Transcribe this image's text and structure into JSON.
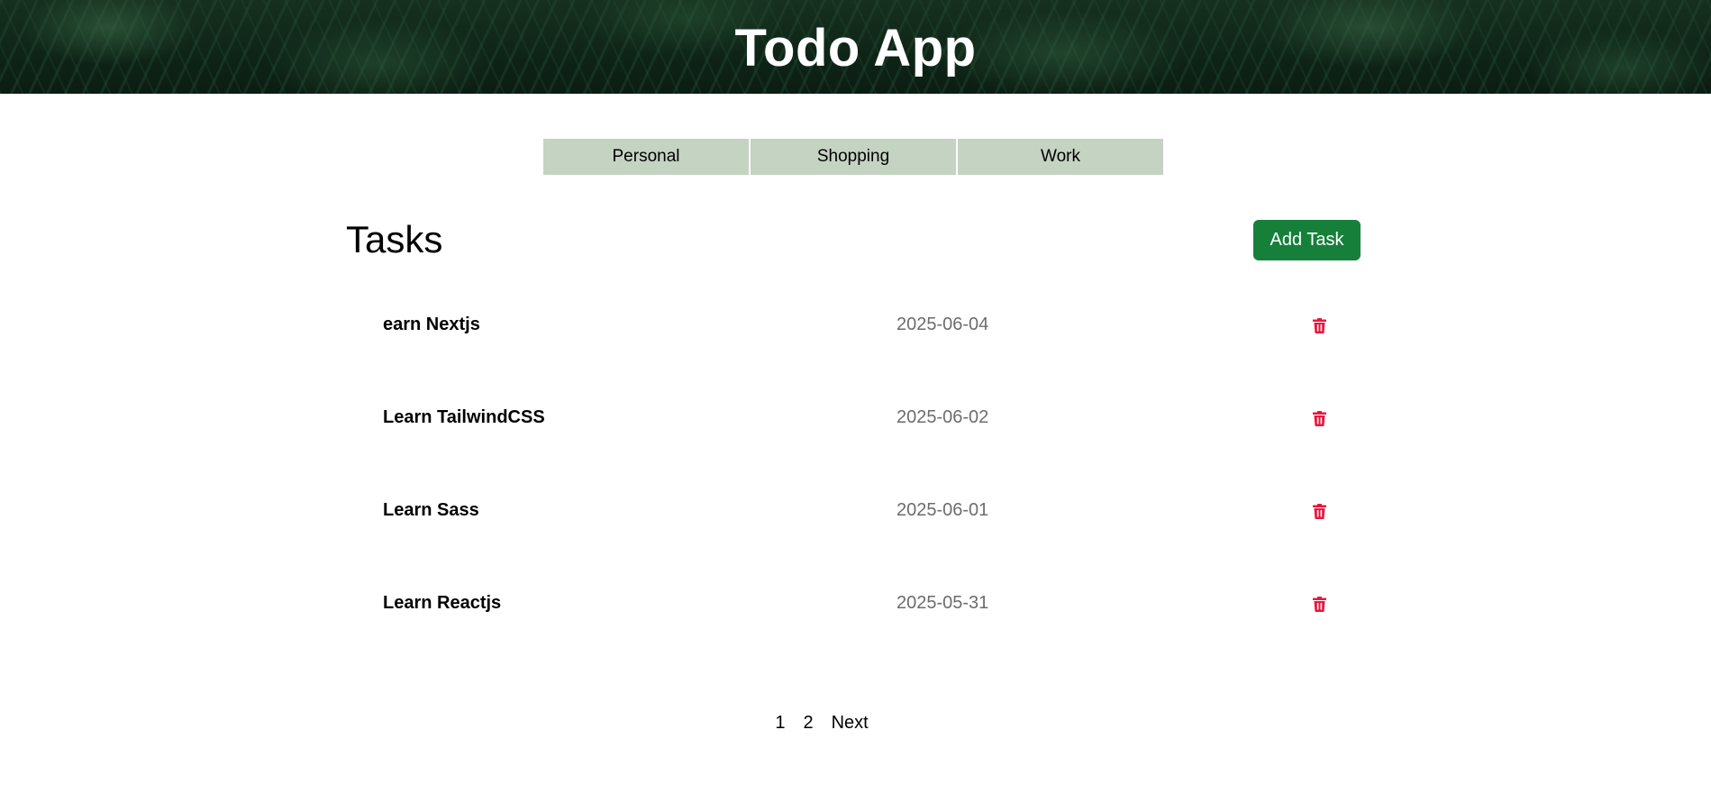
{
  "header": {
    "title": "Todo App"
  },
  "categories": [
    {
      "label": "Personal"
    },
    {
      "label": "Shopping"
    },
    {
      "label": "Work"
    }
  ],
  "main": {
    "title": "Tasks",
    "add_button_label": "Add Task"
  },
  "tasks": [
    {
      "name": "earn Nextjs",
      "date": "2025-06-04",
      "delete_icon": "trash-icon"
    },
    {
      "name": "Learn TailwindCSS",
      "date": "2025-06-02",
      "delete_icon": "trash-icon"
    },
    {
      "name": "Learn Sass",
      "date": "2025-06-01",
      "delete_icon": "trash-icon"
    },
    {
      "name": "Learn Reactjs",
      "date": "2025-05-31",
      "delete_icon": "trash-icon"
    }
  ],
  "pagination": {
    "pages": [
      "1",
      "2"
    ],
    "next_label": "Next"
  },
  "colors": {
    "tab_background": "#c5d3c2",
    "add_button": "#16803b",
    "delete_icon": "#e8173e",
    "date_text": "#6c6c6c"
  }
}
